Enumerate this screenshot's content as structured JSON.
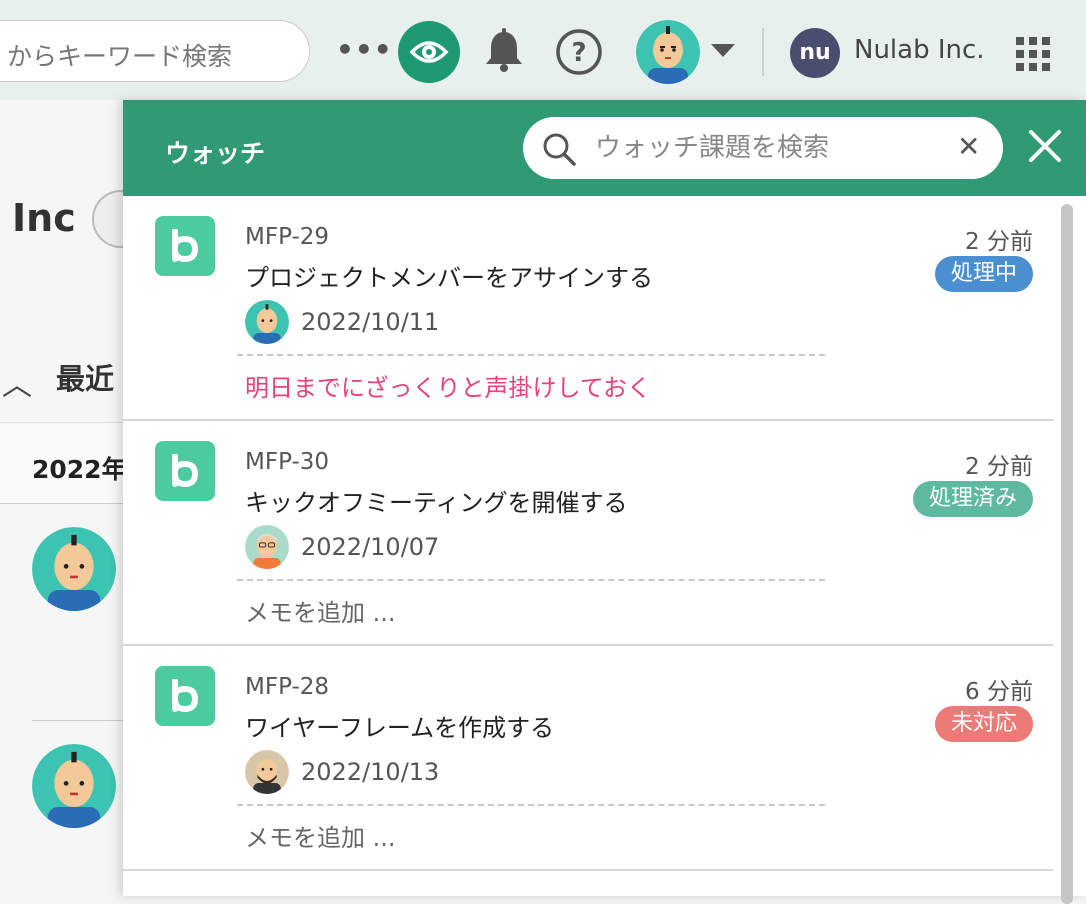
{
  "topbar": {
    "search_placeholder": "からキーワード検索",
    "more_icon": "more-dots-icon",
    "watch_icon": "eye-icon",
    "bell_icon": "bell-icon",
    "help_icon": "help-icon",
    "org_logo_text": "nu",
    "org_name": "Nulab Inc.",
    "apps_icon": "apps-grid-icon"
  },
  "background_page": {
    "title_fragment": "Inc",
    "recent_label": "最近",
    "year_label": "2022年"
  },
  "watch_panel": {
    "title": "ウォッチ",
    "search_placeholder": "ウォッチ課題を検索",
    "clear_label": "✕",
    "items": [
      {
        "key": "MFP-29",
        "summary": "プロジェクトメンバーをアサインする",
        "date": "2022/10/11",
        "memo": "明日までにざっくりと声掛けしておく",
        "time": "2 分前",
        "status": "処理中"
      },
      {
        "key": "MFP-30",
        "summary": "キックオフミーティングを開催する",
        "date": "2022/10/07",
        "memo": "メモを追加 ...",
        "time": "2 分前",
        "status": "処理済み"
      },
      {
        "key": "MFP-28",
        "summary": "ワイヤーフレームを作成する",
        "date": "2022/10/13",
        "memo": "メモを追加 ...",
        "time": "6 分前",
        "status": "未対応"
      }
    ]
  },
  "colors": {
    "brand_green": "#2f9a74",
    "status_in_progress": "#4a8fd0",
    "status_resolved": "#5fb8a0",
    "status_open": "#ec7a77",
    "memo_red": "#e8427a"
  }
}
